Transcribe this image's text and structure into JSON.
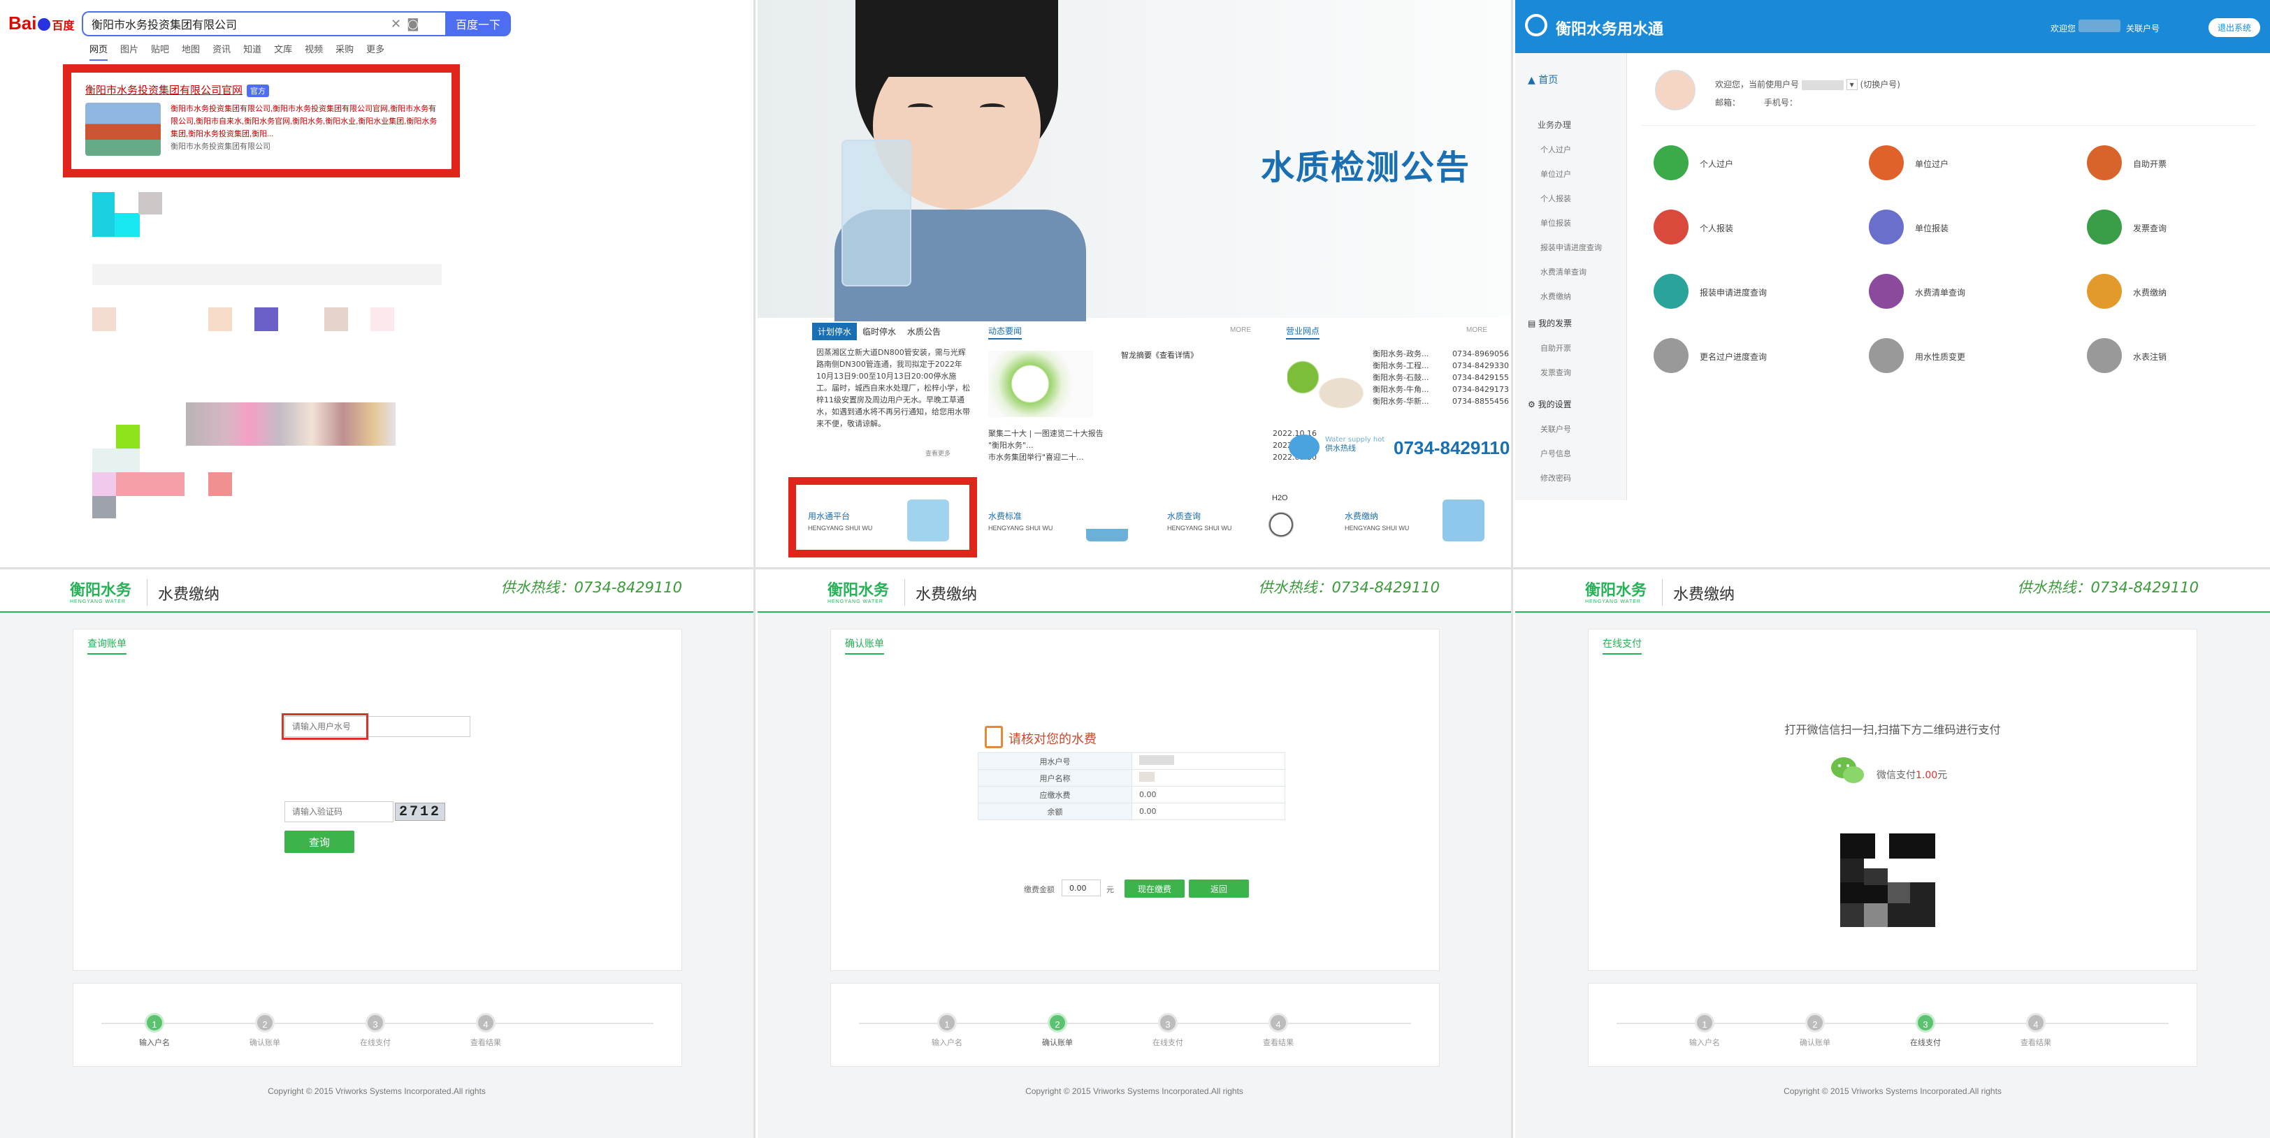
{
  "baidu": {
    "logo_text": "Bai",
    "logo_text2": "百度",
    "query": "衡阳市水务投资集团有限公司",
    "search_button": "百度一下",
    "tabs": [
      "网页",
      "图片",
      "贴吧",
      "地图",
      "资讯",
      "知道",
      "文库",
      "视频",
      "采购",
      "更多"
    ],
    "result_title": "衡阳市水务投资集团有限公司官网",
    "result_tag": "官方",
    "result_desc_highlight": "衡阳市水务投资集团有限公司,衡阳市水务投资集团有限公司官网,衡阳市水务有限公司,衡阳市自来水,衡阳水务官网,衡阳水务,衡阳水业,衡阳水业集团,衡阳水务集团,衡阳水务投资集团,衡阳...",
    "result_site": "衡阳市水务投资集团有限公司"
  },
  "portal": {
    "banner_title": "水质检测公告",
    "tabs": [
      "计划停水",
      "临时停水",
      "水质公告"
    ],
    "notice_text": "因蒸湘区立新大道DN800管安装，需与光辉路南侧DN300管连通，我司拟定于2022年10月13日9:00至10月13日20:00停水施工。届时，城西自来水处理厂，松梓小学，松梓11级安置房及周边用户无水。早晚工草通水，如遇到通水将不再另行通知，给您用水带来不便，敬请谅解。",
    "notice_more": "查看更多",
    "news_head": "动态要闻",
    "news_more": "MORE",
    "news_brief": "智龙摘要《查看详情》",
    "news_items": [
      {
        "title": "聚集二十大 | 一图速览二十大报告",
        "date": "2022.10.16"
      },
      {
        "title": "\"衡阳水务\"...",
        "date": "2022.10.11"
      },
      {
        "title": "市水务集团举行\"喜迎二十...",
        "date": "2022.09.30"
      }
    ],
    "outlet_head": "营业网点",
    "outlets": [
      {
        "name": "衡阳水务-政务...",
        "phone": "0734-8969056"
      },
      {
        "name": "衡阳水务-工程...",
        "phone": "0734-8429330"
      },
      {
        "name": "衡阳水务-石鼓...",
        "phone": "0734-8429155"
      },
      {
        "name": "衡阳水务-牛角...",
        "phone": "0734-8429173"
      },
      {
        "name": "衡阳水务-华新...",
        "phone": "0734-8855456"
      }
    ],
    "hotline_en": "Water supply hot",
    "hotline_cn": "供水热线",
    "hotline_number": "0734-8429110",
    "services": [
      {
        "name": "用水通平台",
        "en": "HENGYANG SHUI WU"
      },
      {
        "name": "水费标准",
        "en": "HENGYANG SHUI WU"
      },
      {
        "name": "水质查询",
        "en": "HENGYANG SHUI WU"
      },
      {
        "name": "水费缴纳",
        "en": "HENGYANG SHUI WU"
      }
    ],
    "h2o": "H2O"
  },
  "app": {
    "title": "衡阳水务用水通",
    "welcome": "欢迎您",
    "bind": "关联户号",
    "logout": "退出系统",
    "home": "首页",
    "menu": {
      "business": "业务办理",
      "business_items": [
        "个人过户",
        "单位过户",
        "个人报装",
        "单位报装",
        "报装申请进度查询",
        "水费清单查询",
        "水费缴纳"
      ],
      "invoice": "我的发票",
      "invoice_items": [
        "自助开票",
        "发票查询"
      ],
      "settings": "我的设置",
      "settings_items": [
        "关联户号",
        "户号信息",
        "修改密码"
      ]
    },
    "user_line1": "欢迎您，当前使用户号",
    "user_switch": "(切换户号)",
    "user_line2": "邮箱：",
    "user_phone": "手机号：",
    "functions": [
      {
        "name": "个人过户",
        "color": "#3bab4a"
      },
      {
        "name": "单位过户",
        "color": "#e0622a"
      },
      {
        "name": "自助开票",
        "color": "#d9642b"
      },
      {
        "name": "个人报装",
        "color": "#d94a3d"
      },
      {
        "name": "单位报装",
        "color": "#6a6fcb"
      },
      {
        "name": "发票查询",
        "color": "#3a9e48"
      },
      {
        "name": "报装申请进度查询",
        "color": "#2aa39a"
      },
      {
        "name": "水费清单查询",
        "color": "#8c4a9c"
      },
      {
        "name": "水费缴纳",
        "color": "#e39a2a"
      },
      {
        "name": "更名过户进度查询",
        "color": "#999999"
      },
      {
        "name": "用水性质变更",
        "color": "#999999"
      },
      {
        "name": "水表注销",
        "color": "#999999"
      }
    ]
  },
  "pay": {
    "logo": "衡阳水务",
    "logo_en": "HENGYANG WATER",
    "title": "水费缴纳",
    "hotline": "供水热线：0734-8429110",
    "steps": [
      "输入户名",
      "确认账单",
      "在线支付",
      "查看结果"
    ],
    "copyright": "Copyright © 2015 Vriworks Systems Incorporated.All rights",
    "query": {
      "card_title": "查询账单",
      "account_placeholder": "请输入用户水号",
      "captcha_placeholder": "请输入验证码",
      "captcha": "2712",
      "button": "查询"
    },
    "confirm": {
      "card_title": "确认账单",
      "heading": "请核对您的水费",
      "rows": [
        {
          "k": "用水户号",
          "v": ""
        },
        {
          "k": "用户名称",
          "v": ""
        },
        {
          "k": "应缴水费",
          "v": "0.00"
        },
        {
          "k": "余额",
          "v": "0.00"
        }
      ],
      "amount_label": "缴费金额",
      "amount_value": "0.00",
      "unit": "元",
      "pay_button": "现在缴费",
      "back_button": "返回"
    },
    "online": {
      "card_title": "在线支付",
      "instruction": "打开微信信扫一扫,扫描下方二维码进行支付",
      "wechat_label": "微信支付",
      "amount": "1.00",
      "unit": "元"
    }
  }
}
